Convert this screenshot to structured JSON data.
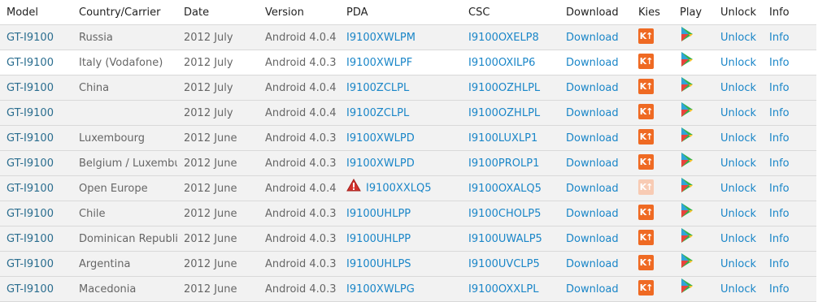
{
  "colors": {
    "link": "#1a86c8",
    "kies": "#ef6a23",
    "kies_faded": "#f8cbb4",
    "row_bg": "#f2f2f2"
  },
  "headers": [
    "Model",
    "Country/Carrier",
    "Date",
    "Version",
    "PDA",
    "CSC",
    "Download",
    "Kies",
    "Play",
    "Unlock",
    "Info"
  ],
  "rows": [
    {
      "model": "GT-I9100",
      "country": "Russia",
      "date": "2012 July",
      "version": "Android 4.0.4",
      "pda": "I9100XWLPM",
      "csc": "I9100OXELP8",
      "download": "Download",
      "kies": "kies-icon",
      "play": "play-icon",
      "unlock": "Unlock",
      "info": "Info"
    },
    {
      "model": "GT-I9100",
      "country": "Italy (Vodafone)",
      "date": "2012 July",
      "version": "Android 4.0.3",
      "pda": "I9100XWLPF",
      "csc": "I9100OXILP6",
      "download": "Download",
      "kies": "kies-icon",
      "play": "play-icon",
      "unlock": "Unlock",
      "info": "Info"
    },
    {
      "model": "GT-I9100",
      "country": "China",
      "date": "2012 July",
      "version": "Android 4.0.4",
      "pda": "I9100ZCLPL",
      "csc": "I9100OZHLPL",
      "download": "Download",
      "kies": "kies-icon",
      "play": "play-icon",
      "unlock": "Unlock",
      "info": "Info"
    },
    {
      "model": "GT-I9100",
      "country": "",
      "date": "2012 July",
      "version": "Android 4.0.4",
      "pda": "I9100ZCLPL",
      "csc": "I9100OZHLPL",
      "download": "Download",
      "kies": "kies-icon",
      "play": "play-icon",
      "unlock": "Unlock",
      "info": "Info"
    },
    {
      "model": "GT-I9100",
      "country": "Luxembourg",
      "date": "2012 June",
      "version": "Android 4.0.3",
      "pda": "I9100XWLPD",
      "csc": "I9100LUXLP1",
      "download": "Download",
      "kies": "kies-icon",
      "play": "play-icon",
      "unlock": "Unlock",
      "info": "Info"
    },
    {
      "model": "GT-I9100",
      "country": "Belgium / Luxembu",
      "date": "2012 June",
      "version": "Android 4.0.3",
      "pda": "I9100XWLPD",
      "csc": "I9100PROLP1",
      "download": "Download",
      "kies": "kies-icon",
      "play": "play-icon",
      "unlock": "Unlock",
      "info": "Info"
    },
    {
      "model": "GT-I9100",
      "country": "Open Europe",
      "date": "2012 June",
      "version": "Android 4.0.4",
      "pda": "I9100XXLQ5",
      "csc": "I9100OXALQ5",
      "download": "Download",
      "kies": "kies-icon",
      "play": "play-icon",
      "unlock": "Unlock",
      "info": "Info"
    },
    {
      "model": "GT-I9100",
      "country": "Chile",
      "date": "2012 June",
      "version": "Android 4.0.3",
      "pda": "I9100UHLPP",
      "csc": "I9100CHOLP5",
      "download": "Download",
      "kies": "kies-icon",
      "play": "play-icon",
      "unlock": "Unlock",
      "info": "Info"
    },
    {
      "model": "GT-I9100",
      "country": "Dominican Republic",
      "date": "2012 June",
      "version": "Android 4.0.3",
      "pda": "I9100UHLPP",
      "csc": "I9100UWALP5",
      "download": "Download",
      "kies": "kies-icon",
      "play": "play-icon",
      "unlock": "Unlock",
      "info": "Info"
    },
    {
      "model": "GT-I9100",
      "country": "Argentina",
      "date": "2012 June",
      "version": "Android 4.0.3",
      "pda": "I9100UHLPS",
      "csc": "I9100UVCLP5",
      "download": "Download",
      "kies": "kies-icon",
      "play": "play-icon",
      "unlock": "Unlock",
      "info": "Info"
    },
    {
      "model": "GT-I9100",
      "country": "Macedonia",
      "date": "2012 June",
      "version": "Android 4.0.3",
      "pda": "I9100XWLPG",
      "csc": "I9100OXXLPL",
      "download": "Download",
      "kies": "kies-icon",
      "play": "play-icon",
      "unlock": "Unlock",
      "info": "Info"
    }
  ]
}
